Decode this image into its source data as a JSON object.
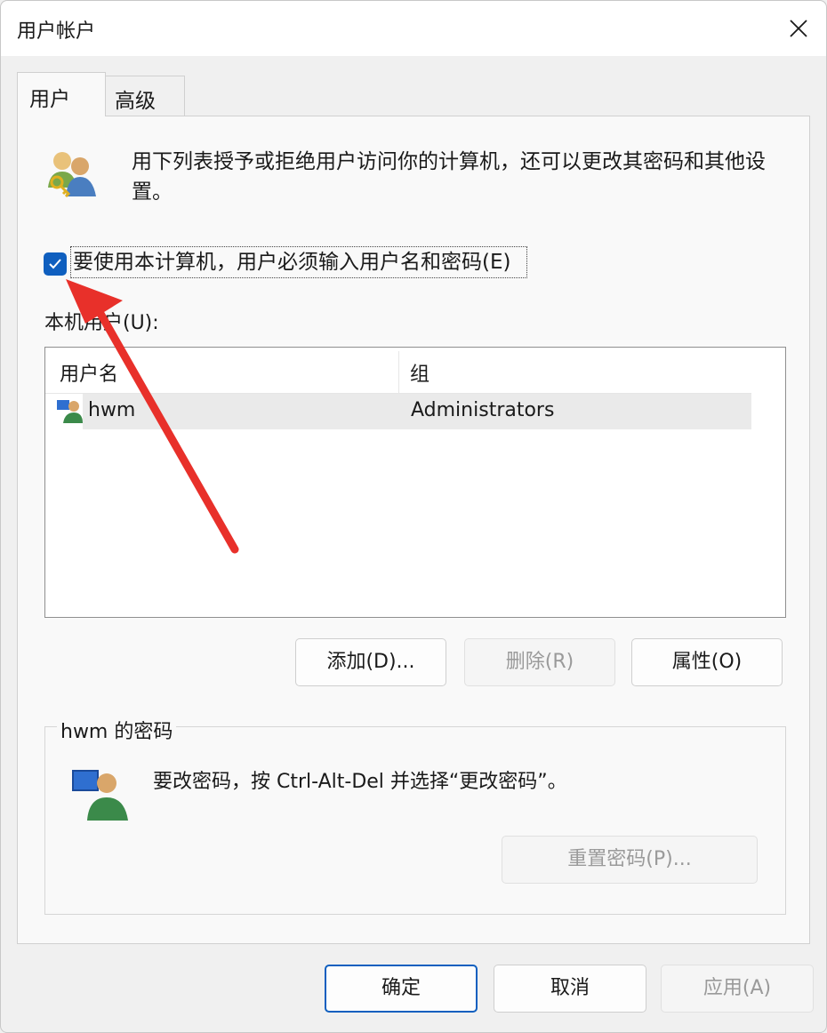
{
  "window": {
    "title": "用户帐户"
  },
  "tabs": [
    {
      "label": "用户"
    },
    {
      "label": "高级"
    }
  ],
  "intro": {
    "text": "用下列表授予或拒绝用户访问你的计算机，还可以更改其密码和其他设置。"
  },
  "require_login": {
    "label": "要使用本计算机，用户必须输入用户名和密码(E)",
    "checked": true
  },
  "users": {
    "label": "本机用户(U):",
    "columns": [
      "用户名",
      "组"
    ],
    "rows": [
      {
        "name": "hwm",
        "group": "Administrators"
      }
    ]
  },
  "buttons": {
    "add": "添加(D)...",
    "remove": "删除(R)",
    "properties": "属性(O)"
  },
  "password": {
    "legend": "hwm 的密码",
    "text": "要改密码，按 Ctrl-Alt-Del 并选择“更改密码”。",
    "reset_button": "重置密码(P)..."
  },
  "footer": {
    "ok": "确定",
    "cancel": "取消",
    "apply": "应用(A)"
  },
  "colors": {
    "accent": "#0f5fbf",
    "annotation_arrow": "#e8302a"
  }
}
